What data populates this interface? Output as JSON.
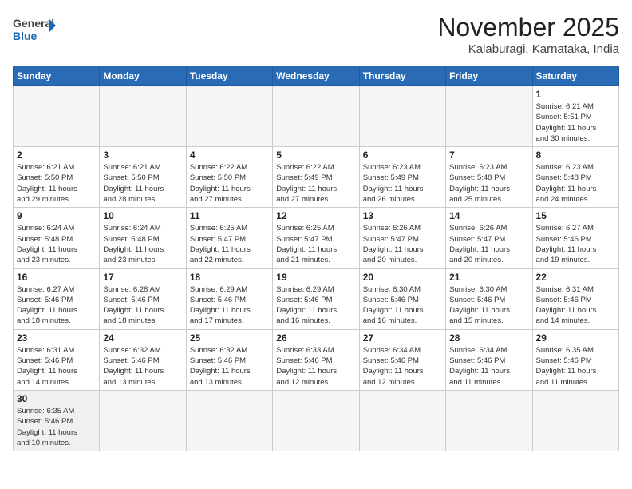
{
  "header": {
    "logo_general": "General",
    "logo_blue": "Blue",
    "month_title": "November 2025",
    "location": "Kalaburagi, Karnataka, India"
  },
  "weekdays": [
    "Sunday",
    "Monday",
    "Tuesday",
    "Wednesday",
    "Thursday",
    "Friday",
    "Saturday"
  ],
  "weeks": [
    [
      {
        "day": "",
        "info": ""
      },
      {
        "day": "",
        "info": ""
      },
      {
        "day": "",
        "info": ""
      },
      {
        "day": "",
        "info": ""
      },
      {
        "day": "",
        "info": ""
      },
      {
        "day": "",
        "info": ""
      },
      {
        "day": "1",
        "info": "Sunrise: 6:21 AM\nSunset: 5:51 PM\nDaylight: 11 hours\nand 30 minutes."
      }
    ],
    [
      {
        "day": "2",
        "info": "Sunrise: 6:21 AM\nSunset: 5:50 PM\nDaylight: 11 hours\nand 29 minutes."
      },
      {
        "day": "3",
        "info": "Sunrise: 6:21 AM\nSunset: 5:50 PM\nDaylight: 11 hours\nand 28 minutes."
      },
      {
        "day": "4",
        "info": "Sunrise: 6:22 AM\nSunset: 5:50 PM\nDaylight: 11 hours\nand 27 minutes."
      },
      {
        "day": "5",
        "info": "Sunrise: 6:22 AM\nSunset: 5:49 PM\nDaylight: 11 hours\nand 27 minutes."
      },
      {
        "day": "6",
        "info": "Sunrise: 6:23 AM\nSunset: 5:49 PM\nDaylight: 11 hours\nand 26 minutes."
      },
      {
        "day": "7",
        "info": "Sunrise: 6:23 AM\nSunset: 5:48 PM\nDaylight: 11 hours\nand 25 minutes."
      },
      {
        "day": "8",
        "info": "Sunrise: 6:23 AM\nSunset: 5:48 PM\nDaylight: 11 hours\nand 24 minutes."
      }
    ],
    [
      {
        "day": "9",
        "info": "Sunrise: 6:24 AM\nSunset: 5:48 PM\nDaylight: 11 hours\nand 23 minutes."
      },
      {
        "day": "10",
        "info": "Sunrise: 6:24 AM\nSunset: 5:48 PM\nDaylight: 11 hours\nand 23 minutes."
      },
      {
        "day": "11",
        "info": "Sunrise: 6:25 AM\nSunset: 5:47 PM\nDaylight: 11 hours\nand 22 minutes."
      },
      {
        "day": "12",
        "info": "Sunrise: 6:25 AM\nSunset: 5:47 PM\nDaylight: 11 hours\nand 21 minutes."
      },
      {
        "day": "13",
        "info": "Sunrise: 6:26 AM\nSunset: 5:47 PM\nDaylight: 11 hours\nand 20 minutes."
      },
      {
        "day": "14",
        "info": "Sunrise: 6:26 AM\nSunset: 5:47 PM\nDaylight: 11 hours\nand 20 minutes."
      },
      {
        "day": "15",
        "info": "Sunrise: 6:27 AM\nSunset: 5:46 PM\nDaylight: 11 hours\nand 19 minutes."
      }
    ],
    [
      {
        "day": "16",
        "info": "Sunrise: 6:27 AM\nSunset: 5:46 PM\nDaylight: 11 hours\nand 18 minutes."
      },
      {
        "day": "17",
        "info": "Sunrise: 6:28 AM\nSunset: 5:46 PM\nDaylight: 11 hours\nand 18 minutes."
      },
      {
        "day": "18",
        "info": "Sunrise: 6:29 AM\nSunset: 5:46 PM\nDaylight: 11 hours\nand 17 minutes."
      },
      {
        "day": "19",
        "info": "Sunrise: 6:29 AM\nSunset: 5:46 PM\nDaylight: 11 hours\nand 16 minutes."
      },
      {
        "day": "20",
        "info": "Sunrise: 6:30 AM\nSunset: 5:46 PM\nDaylight: 11 hours\nand 16 minutes."
      },
      {
        "day": "21",
        "info": "Sunrise: 6:30 AM\nSunset: 5:46 PM\nDaylight: 11 hours\nand 15 minutes."
      },
      {
        "day": "22",
        "info": "Sunrise: 6:31 AM\nSunset: 5:46 PM\nDaylight: 11 hours\nand 14 minutes."
      }
    ],
    [
      {
        "day": "23",
        "info": "Sunrise: 6:31 AM\nSunset: 5:46 PM\nDaylight: 11 hours\nand 14 minutes."
      },
      {
        "day": "24",
        "info": "Sunrise: 6:32 AM\nSunset: 5:46 PM\nDaylight: 11 hours\nand 13 minutes."
      },
      {
        "day": "25",
        "info": "Sunrise: 6:32 AM\nSunset: 5:46 PM\nDaylight: 11 hours\nand 13 minutes."
      },
      {
        "day": "26",
        "info": "Sunrise: 6:33 AM\nSunset: 5:46 PM\nDaylight: 11 hours\nand 12 minutes."
      },
      {
        "day": "27",
        "info": "Sunrise: 6:34 AM\nSunset: 5:46 PM\nDaylight: 11 hours\nand 12 minutes."
      },
      {
        "day": "28",
        "info": "Sunrise: 6:34 AM\nSunset: 5:46 PM\nDaylight: 11 hours\nand 11 minutes."
      },
      {
        "day": "29",
        "info": "Sunrise: 6:35 AM\nSunset: 5:46 PM\nDaylight: 11 hours\nand 11 minutes."
      }
    ],
    [
      {
        "day": "30",
        "info": "Sunrise: 6:35 AM\nSunset: 5:46 PM\nDaylight: 11 hours\nand 10 minutes."
      },
      {
        "day": "",
        "info": ""
      },
      {
        "day": "",
        "info": ""
      },
      {
        "day": "",
        "info": ""
      },
      {
        "day": "",
        "info": ""
      },
      {
        "day": "",
        "info": ""
      },
      {
        "day": "",
        "info": ""
      }
    ]
  ]
}
